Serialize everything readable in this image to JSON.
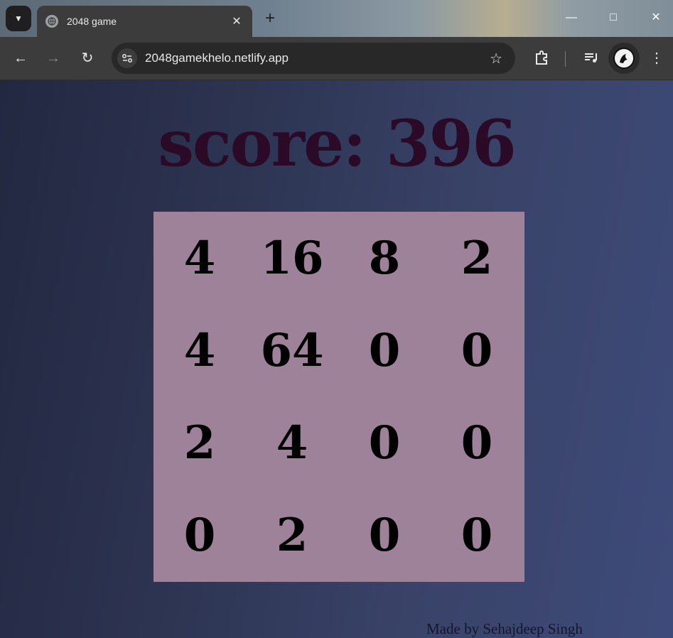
{
  "browser": {
    "tab_title": "2048 game",
    "url": "2048gamekhelo.netlify.app"
  },
  "game": {
    "score_label": "score:",
    "score_value": "396",
    "grid": [
      [
        "4",
        "16",
        "8",
        "2"
      ],
      [
        "4",
        "64",
        "0",
        "0"
      ],
      [
        "2",
        "4",
        "0",
        "0"
      ],
      [
        "0",
        "2",
        "0",
        "0"
      ]
    ],
    "credit": "Made by Sehajdeep Singh"
  },
  "colors": {
    "board": "#9e8299",
    "score_text": "#2a0a26",
    "background_start": "#232841",
    "background_end": "#3e4a7a"
  }
}
